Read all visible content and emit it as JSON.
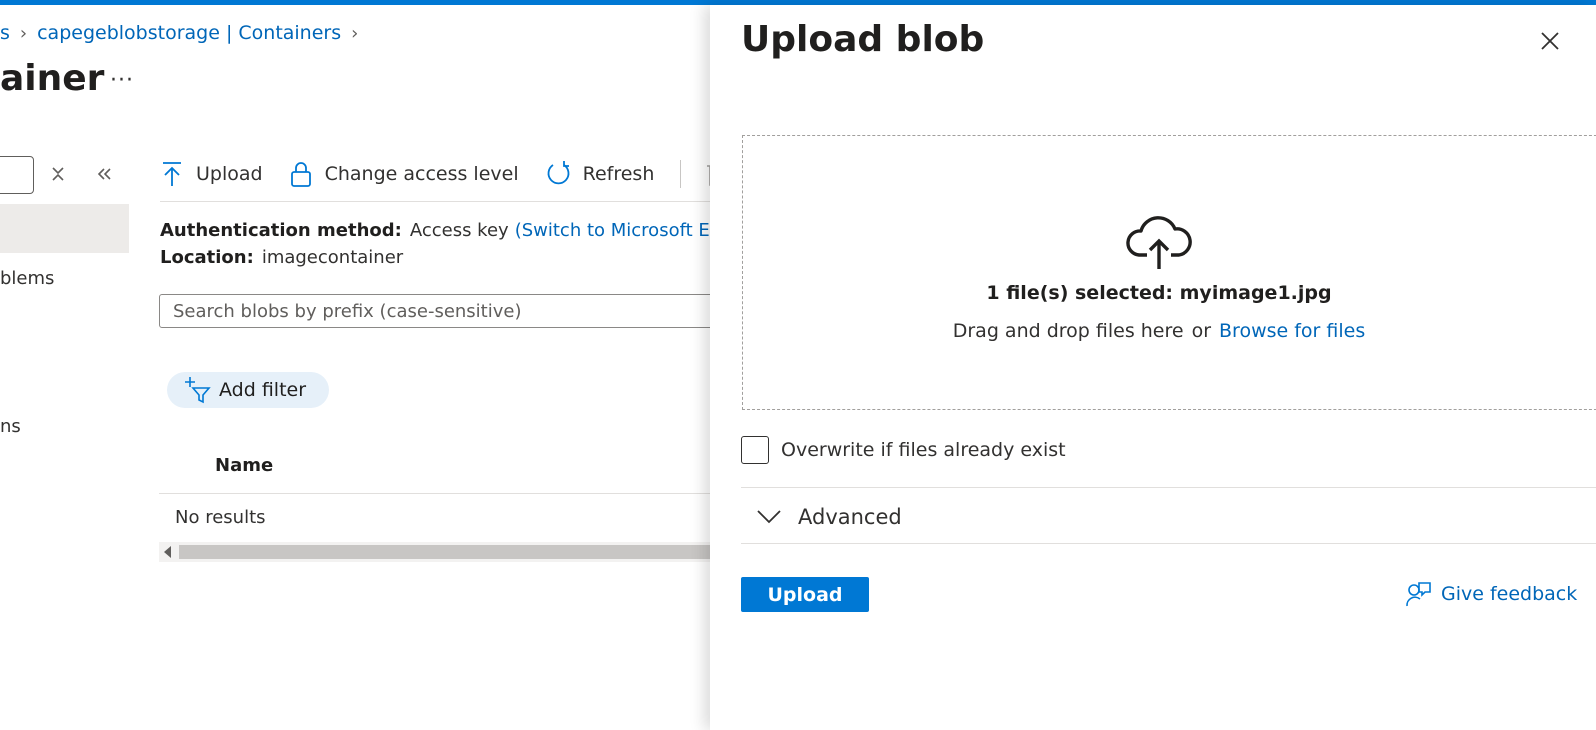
{
  "breadcrumb": {
    "prev_fragment": "s",
    "storage_link": "capegeblobstorage | Containers"
  },
  "page": {
    "title_fragment": "ainer",
    "more_label": "···"
  },
  "nav": {
    "fragment_1": "blems",
    "fragment_2": "ns"
  },
  "toolbar": {
    "upload_label": "Upload",
    "change_access_label": "Change access level",
    "refresh_label": "Refresh"
  },
  "info": {
    "auth_label": "Authentication method:",
    "auth_value": "Access key",
    "auth_switch_link": "(Switch to Microsoft Entra",
    "location_label": "Location:",
    "location_value": "imagecontainer"
  },
  "search": {
    "placeholder": "Search blobs by prefix (case-sensitive)"
  },
  "filter": {
    "add_label": "Add filter"
  },
  "table": {
    "columns": [
      "Name"
    ],
    "empty_text": "No results"
  },
  "panel": {
    "title": "Upload blob",
    "selected_files": "1 file(s) selected: myimage1.jpg",
    "drag_text": "Drag and drop files here",
    "or_text": "or",
    "browse_link": "Browse for files",
    "overwrite_label": "Overwrite if files already exist",
    "overwrite_checked": false,
    "advanced_label": "Advanced",
    "upload_button": "Upload",
    "feedback_link": "Give feedback"
  },
  "colors": {
    "accent": "#0078d4",
    "link": "#0066b8"
  }
}
